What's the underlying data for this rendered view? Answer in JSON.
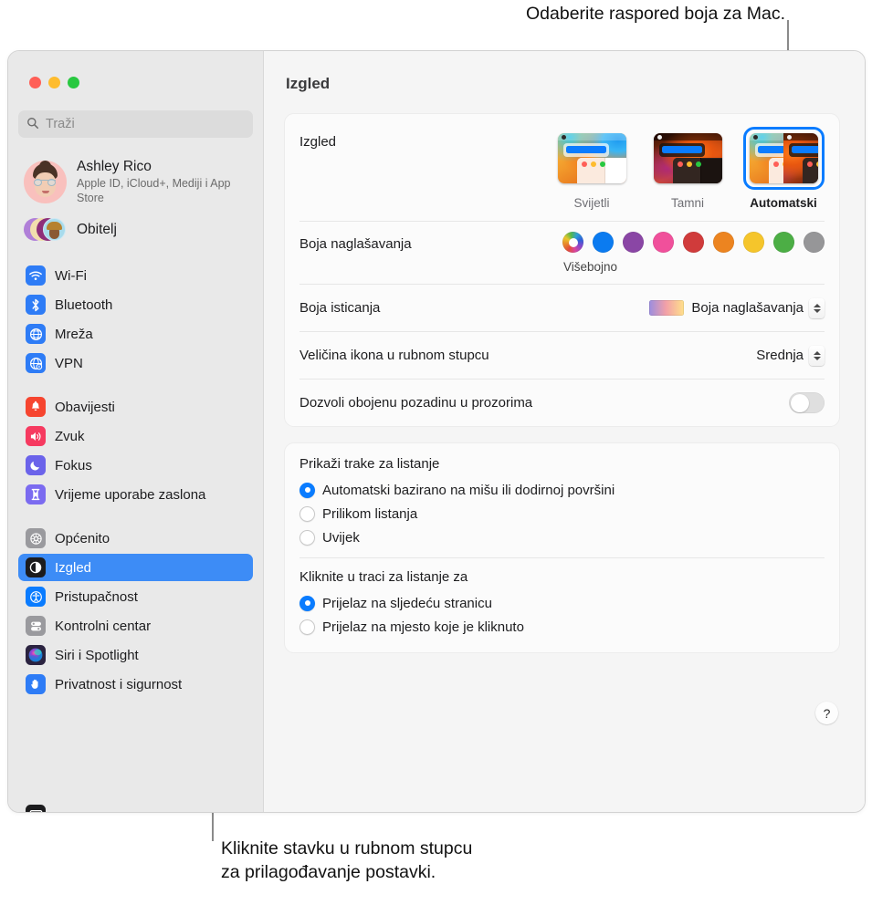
{
  "callouts": {
    "top": "Odaberite raspored boja za Mac.",
    "bottom": "Kliknite stavku u rubnom stupcu\nza prilagođavanje postavki."
  },
  "window": {
    "traffic_lights": [
      "close",
      "minimize",
      "zoom"
    ],
    "pane_title": "Izgled"
  },
  "sidebar": {
    "search": {
      "placeholder": "Traži",
      "icon": "search-icon"
    },
    "account": {
      "name": "Ashley Rico",
      "subtitle": "Apple ID, iCloud+, Mediji i App Store",
      "avatar": "memoji-avatar"
    },
    "family": {
      "label": "Obitelj",
      "icon": "family-avatars-icon"
    },
    "groups": [
      {
        "items": [
          {
            "label": "Wi-Fi",
            "icon": "wifi-icon",
            "color": "#2e7cf6",
            "selected": false
          },
          {
            "label": "Bluetooth",
            "icon": "bluetooth-icon",
            "color": "#2e7cf6",
            "selected": false
          },
          {
            "label": "Mreža",
            "icon": "globe-icon",
            "color": "#2e7cf6",
            "selected": false
          },
          {
            "label": "VPN",
            "icon": "vpn-globe-icon",
            "color": "#2e7cf6",
            "selected": false
          }
        ]
      },
      {
        "items": [
          {
            "label": "Obavijesti",
            "icon": "bell-icon",
            "color": "#f6452f",
            "selected": false
          },
          {
            "label": "Zvuk",
            "icon": "speaker-icon",
            "color": "#f63a60",
            "selected": false
          },
          {
            "label": "Fokus",
            "icon": "moon-icon",
            "color": "#6b63ea",
            "selected": false
          },
          {
            "label": "Vrijeme uporabe zaslona",
            "icon": "hourglass-icon",
            "color": "#7b6bf0",
            "selected": false
          }
        ]
      },
      {
        "items": [
          {
            "label": "Općenito",
            "icon": "gear-icon",
            "color": "#9a9a9e",
            "selected": false
          },
          {
            "label": "Izgled",
            "icon": "appearance-icon",
            "color": "#1c1c1e",
            "selected": true
          },
          {
            "label": "Pristupačnost",
            "icon": "accessibility-icon",
            "color": "#0a7cff",
            "selected": false
          },
          {
            "label": "Kontrolni centar",
            "icon": "control-center-icon",
            "color": "#9a9a9e",
            "selected": false
          },
          {
            "label": "Siri i Spotlight",
            "icon": "siri-icon",
            "color": "#2b2340",
            "selected": false
          },
          {
            "label": "Privatnost i sigurnost",
            "icon": "hand-privacy-icon",
            "color": "#2e7cf6",
            "selected": false
          }
        ]
      }
    ]
  },
  "main": {
    "appearance": {
      "label": "Izgled",
      "options": [
        {
          "name": "Svijetli",
          "selected": false
        },
        {
          "name": "Tamni",
          "selected": false
        },
        {
          "name": "Automatski",
          "selected": true
        }
      ]
    },
    "accent": {
      "label": "Boja naglašavanja",
      "caption": "Višebojno",
      "selected_index": 0,
      "swatches": [
        {
          "name": "multicolour",
          "color": "multi"
        },
        {
          "name": "blue",
          "color": "#0b7bf0"
        },
        {
          "name": "purple",
          "color": "#8a46a5"
        },
        {
          "name": "pink",
          "color": "#f0509b"
        },
        {
          "name": "red",
          "color": "#d03b3b"
        },
        {
          "name": "orange",
          "color": "#ec8420"
        },
        {
          "name": "yellow",
          "color": "#f5c52b"
        },
        {
          "name": "green",
          "color": "#4cae45"
        },
        {
          "name": "graphite",
          "color": "#969698"
        }
      ]
    },
    "highlight": {
      "label": "Boja isticanja",
      "value": "Boja naglašavanja",
      "swatch": "gradient-swatch"
    },
    "sidebar_icon_size": {
      "label": "Veličina ikona u rubnom stupcu",
      "value": "Srednja"
    },
    "wallpaper_tinting": {
      "label": "Dozvoli obojenu pozadinu u prozorima",
      "enabled": false
    },
    "scrollbars": {
      "heading": "Prikaži trake za listanje",
      "options": [
        {
          "label": "Automatski bazirano na mišu ili dodirnoj površini",
          "selected": true
        },
        {
          "label": "Prilikom listanja",
          "selected": false
        },
        {
          "label": "Uvijek",
          "selected": false
        }
      ]
    },
    "scroll_click": {
      "heading": "Kliknite u traci za listanje za",
      "options": [
        {
          "label": "Prijelaz na sljedeću stranicu",
          "selected": true
        },
        {
          "label": "Prijelaz na mjesto koje je kliknuto",
          "selected": false
        }
      ]
    },
    "help": {
      "label": "?"
    }
  }
}
